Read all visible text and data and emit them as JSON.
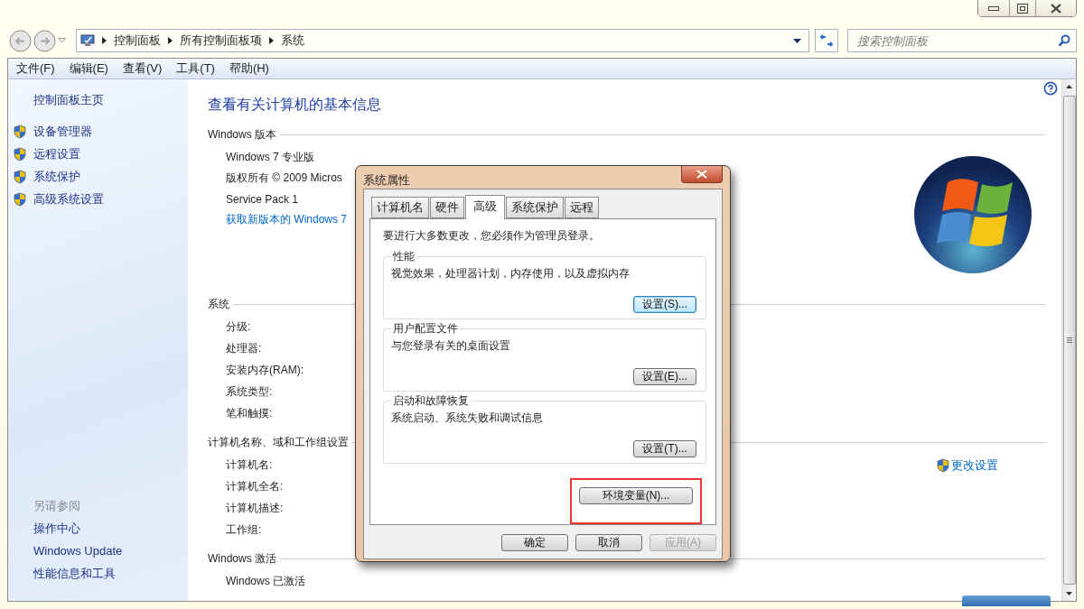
{
  "address_bar": {
    "crumbs": [
      "控制面板",
      "所有控制面板项",
      "系统"
    ]
  },
  "search": {
    "placeholder": "搜索控制面板"
  },
  "menu": [
    "文件(F)",
    "编辑(E)",
    "查看(V)",
    "工具(T)",
    "帮助(H)"
  ],
  "sidebar": {
    "home": "控制面板主页",
    "tasks": [
      "设备管理器",
      "远程设置",
      "系统保护",
      "高级系统设置"
    ],
    "see_also_title": "另请参阅",
    "see_also": [
      "操作中心",
      "Windows Update",
      "性能信息和工具"
    ]
  },
  "content": {
    "title": "查看有关计算机的基本信息",
    "sections": [
      {
        "heading": "Windows 版本",
        "rows": [
          {
            "kind": "text",
            "text": "Windows 7 专业版"
          },
          {
            "kind": "text",
            "text": "版权所有 © 2009 Micros"
          },
          {
            "kind": "text",
            "text": "Service Pack 1"
          },
          {
            "kind": "link",
            "text": "获取新版本的 Windows 7"
          }
        ]
      },
      {
        "heading": "系统",
        "rows": [
          {
            "kind": "text",
            "text": "分级:"
          },
          {
            "kind": "text",
            "text": "处理器:"
          },
          {
            "kind": "text",
            "text": "安装内存(RAM):"
          },
          {
            "kind": "text",
            "text": "系统类型:"
          },
          {
            "kind": "text",
            "text": "笔和触摸:"
          }
        ]
      },
      {
        "heading": "计算机名称、域和工作组设置",
        "action": "更改设置",
        "rows": [
          {
            "kind": "text",
            "text": "计算机名:"
          },
          {
            "kind": "text",
            "text": "计算机全名:"
          },
          {
            "kind": "text",
            "text": "计算机描述:"
          },
          {
            "kind": "text",
            "text": "工作组:"
          }
        ]
      },
      {
        "heading": "Windows 激活",
        "rows": [
          {
            "kind": "text",
            "text": "Windows 已激活"
          }
        ]
      }
    ]
  },
  "dialog": {
    "title": "系统属性",
    "tabs": [
      {
        "label": "计算机名",
        "selected": false
      },
      {
        "label": "硬件",
        "selected": false
      },
      {
        "label": "高级",
        "selected": true
      },
      {
        "label": "系统保护",
        "selected": false
      },
      {
        "label": "远程",
        "selected": false
      }
    ],
    "notice": "要进行大多数更改，您必须作为管理员登录。",
    "groups": [
      {
        "title": "性能",
        "description": "视觉效果，处理器计划，内存使用，以及虚拟内存",
        "button": "设置(S)...",
        "focused": true
      },
      {
        "title": "用户配置文件",
        "description": "与您登录有关的桌面设置",
        "button": "设置(E)...",
        "focused": false
      },
      {
        "title": "启动和故障恢复",
        "description": "系统启动、系统失败和调试信息",
        "button": "设置(T)...",
        "focused": false
      }
    ],
    "env_button": {
      "label": "环境变量(N)...",
      "highlighted": true
    },
    "buttons": [
      {
        "label": "确定",
        "disabled": false
      },
      {
        "label": "取消",
        "disabled": false
      },
      {
        "label": "应用(A)",
        "disabled": true
      }
    ]
  }
}
